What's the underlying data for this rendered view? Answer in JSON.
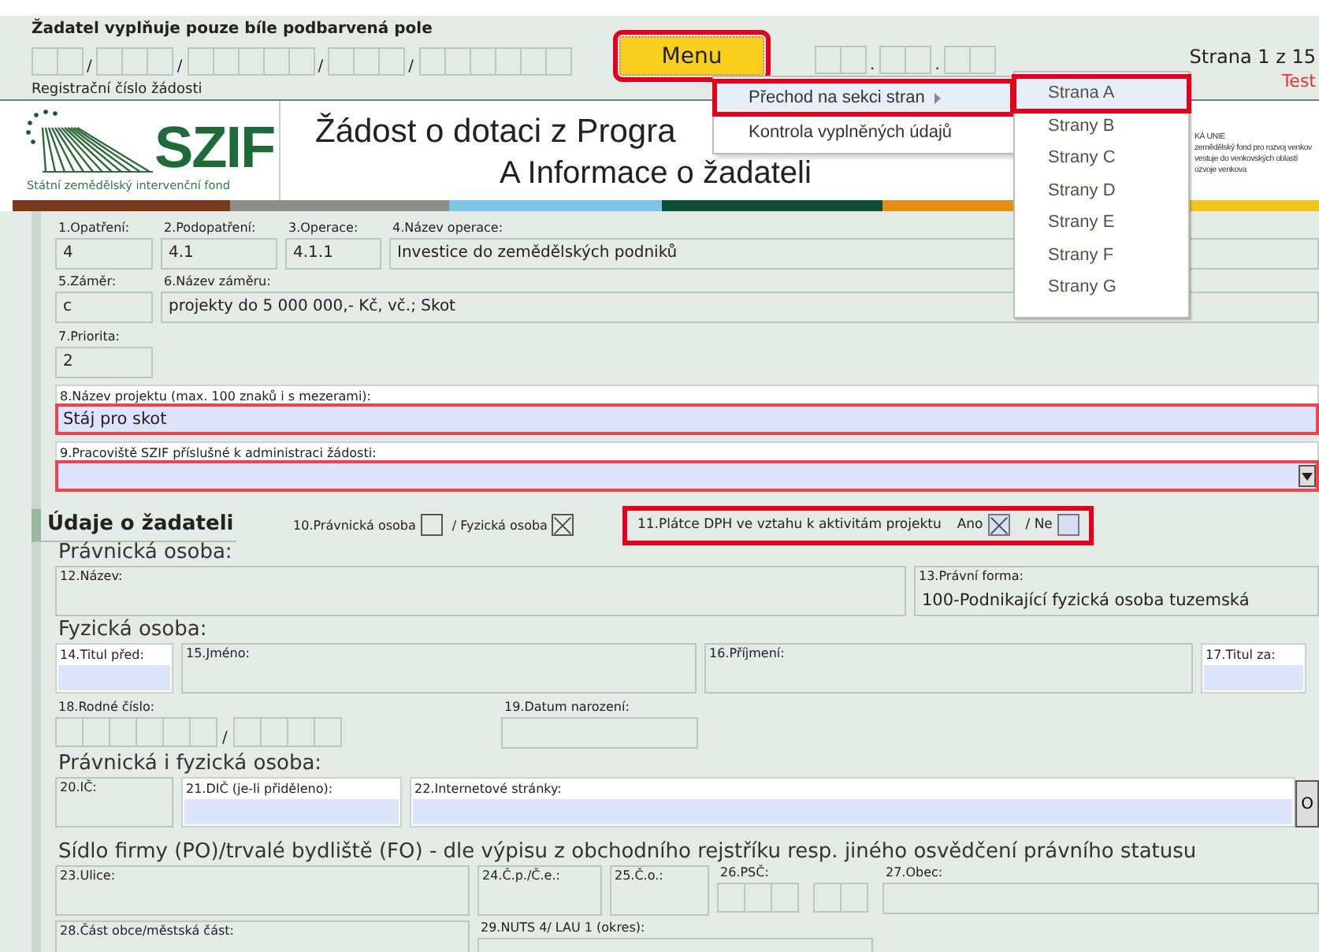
{
  "header": {
    "instruction": "Žadatel vyplňuje pouze bíle podbarvená pole",
    "registration_separators": [
      "/",
      "/",
      "/",
      "/"
    ],
    "registration_label": "Registrační číslo žádosti",
    "menu_button": {
      "label": "Menu",
      "highlighted": true
    },
    "date_separators": [
      ".",
      "."
    ],
    "page_indicator": "Strana 1 z 15",
    "mode": "Test"
  },
  "logo": {
    "name": "SZIF",
    "subtitle": "Státní zemědělský intervenční fond"
  },
  "title": {
    "line_1": "Žádost o dotaci z Progra",
    "line_2": "A Informace o žadateli"
  },
  "eu_note": [
    "KÁ UNIE",
    "zemědělský fond pro rozvoj venkov",
    "vestuje do venkovských oblastí",
    "ozvoje venkova"
  ],
  "form": {
    "blocks": [
      {
        "kind": "fields",
        "fields": [
          {
            "kind": "readonly",
            "label": "1.Opatření:",
            "value": "4"
          },
          {
            "kind": "readonly",
            "label": "2.Podopatření:",
            "value": "4.1"
          },
          {
            "kind": "readonly",
            "label": "3.Operace:",
            "value": "4.1.1"
          },
          {
            "kind": "readonly",
            "label": "4.Název operace:",
            "value": "Investice do zemědělských podniků"
          }
        ]
      },
      {
        "kind": "fields",
        "fields": [
          {
            "kind": "readonly",
            "label": "5.Záměr:",
            "value": "c"
          },
          {
            "kind": "readonly",
            "label": "6.Název záměru:",
            "value": "projekty do 5 000 000,- Kč, vč.; Skot"
          }
        ]
      },
      {
        "kind": "fields",
        "fields": [
          {
            "kind": "readonly",
            "label": "7.Priorita:",
            "value": "2"
          }
        ]
      },
      {
        "kind": "fields",
        "fields": [
          {
            "kind": "input",
            "label": "8.Název projektu (max. 100 znaků i s mezerami):",
            "value": "Stáj pro skot",
            "highlighted": true
          }
        ]
      },
      {
        "kind": "fields",
        "fields": [
          {
            "kind": "select",
            "label": "9.Pracoviště SZIF příslušné k administraci žádosti:",
            "highlighted": true
          }
        ]
      },
      {
        "kind": "applicant_header",
        "title": "Údaje o žadateli",
        "checkboxes": [
          {
            "label": "10.Právnická osoba",
            "checked": false
          },
          {
            "label": "/ Fyzická osoba",
            "checked": true
          }
        ],
        "vat": {
          "label": "11.Plátce DPH ve vztahu k aktivitám projektu",
          "highlighted": true,
          "options": [
            {
              "label": "Ano",
              "checked": true
            },
            {
              "label": "/ Ne",
              "checked": false
            }
          ]
        }
      },
      {
        "kind": "heading",
        "text": "Právnická osoba:"
      },
      {
        "kind": "fields",
        "fields": [
          {
            "kind": "box",
            "label": "12.Název:"
          },
          {
            "kind": "box",
            "label": "13.Právní forma:",
            "value": "100-Podnikající fyzická osoba tuzemská"
          }
        ]
      },
      {
        "kind": "heading",
        "text": "Fyzická osoba:"
      },
      {
        "kind": "fields",
        "fields": [
          {
            "kind": "input",
            "label": "14.Titul před:",
            "highlighted": false
          },
          {
            "kind": "box",
            "label": "15.Jméno:"
          },
          {
            "kind": "box",
            "label": "16.Příjmení:"
          },
          {
            "kind": "input",
            "label": "17.Titul za:",
            "highlighted": false
          }
        ]
      },
      {
        "kind": "fields",
        "fields": [
          {
            "kind": "cells",
            "label": "18.Rodné číslo:",
            "separators": [
              "/"
            ]
          },
          {
            "kind": "readonly",
            "label": "19.Datum narození:"
          }
        ]
      },
      {
        "kind": "heading",
        "text": "Právnická i fyzická osoba:"
      },
      {
        "kind": "fields",
        "fields": [
          {
            "kind": "box",
            "label": "20.IČ:"
          },
          {
            "kind": "input",
            "label": "21.DIČ (je-li přiděleno):",
            "highlighted": false
          },
          {
            "kind": "input",
            "label": "22.Internetové stránky:",
            "highlighted": false,
            "button": "O"
          }
        ]
      },
      {
        "kind": "heading",
        "text": "Sídlo firmy (PO)/trvalé bydliště (FO) - dle výpisu z obchodního rejstříku resp. jiného osvědčení právního statusu"
      },
      {
        "kind": "fields",
        "fields": [
          {
            "kind": "box",
            "label": "23.Ulice:"
          },
          {
            "kind": "box",
            "label": "24.Č.p./Č.e.:"
          },
          {
            "kind": "box",
            "label": "25.Č.o.:"
          },
          {
            "kind": "cells",
            "label": "26.PSČ:"
          },
          {
            "kind": "readonly",
            "label": "27.Obec:"
          }
        ]
      },
      {
        "kind": "fields",
        "fields": [
          {
            "kind": "box",
            "label": "28.Část obce/městská část:"
          },
          {
            "kind": "readonly",
            "label": "29.NUTS 4/ LAU 1 (okres):"
          }
        ]
      }
    ]
  },
  "menu": {
    "items": [
      {
        "label": "Přechod na sekci stran",
        "has_submenu": true,
        "selected": true,
        "highlighted": true
      },
      {
        "label": "Kontrola vyplněných údajů",
        "has_submenu": false,
        "selected": false,
        "highlighted": false
      }
    ],
    "submenu": [
      {
        "label": "Strana A",
        "selected": true,
        "highlighted": true
      },
      {
        "label": "Strany B",
        "selected": false,
        "highlighted": false
      },
      {
        "label": "Strany C",
        "selected": false,
        "highlighted": false
      },
      {
        "label": "Strany D",
        "selected": false,
        "highlighted": false
      },
      {
        "label": "Strany E",
        "selected": false,
        "highlighted": false
      },
      {
        "label": "Strany F",
        "selected": false,
        "highlighted": false
      },
      {
        "label": "Strany G",
        "selected": false,
        "highlighted": false
      }
    ]
  }
}
